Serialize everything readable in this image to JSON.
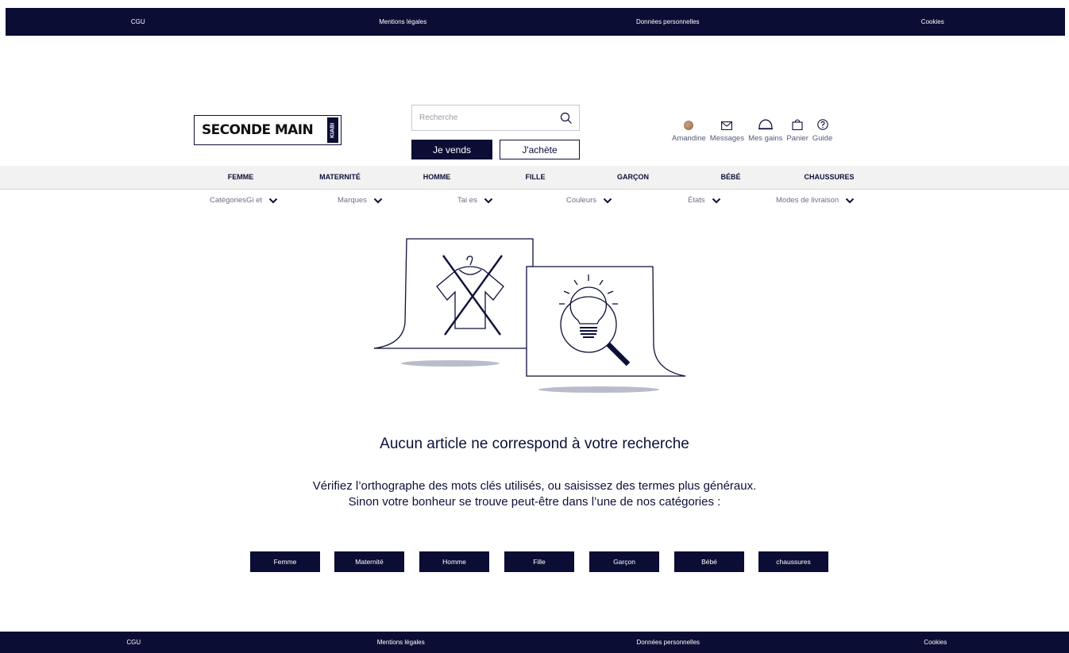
{
  "footer_links": [
    "CGU",
    "Mentions légales",
    "Données personnelles",
    "Cookies"
  ],
  "logo": {
    "text": "SECONDE MAIN",
    "badge": "KIABI"
  },
  "search": {
    "placeholder": "Recherche",
    "value": "",
    "icon": "search-icon"
  },
  "buttons": {
    "sell": "Je vends",
    "buy": "J'achète"
  },
  "user_nav": [
    {
      "label": "Amandine",
      "icon": "avatar"
    },
    {
      "label": "Messages",
      "icon": "envelope-icon"
    },
    {
      "label": "Mes gains",
      "icon": "piggy-bank-icon"
    },
    {
      "label": "Panier",
      "icon": "bag-icon"
    },
    {
      "label": "Guide",
      "icon": "help-icon"
    }
  ],
  "categories": [
    "FEMME",
    "MATERNITÉ",
    "HOMME",
    "FILLE",
    "GARÇON",
    "BÉBÉ",
    "CHAUSSURES"
  ],
  "filters": [
    "CatégoriesGi et",
    "Marques",
    "Tai es",
    "Couleurs",
    "États",
    "Modes de livraison"
  ],
  "empty_state": {
    "title": "Aucun article ne correspond à votre recherche",
    "line1": "Vérifiez l’orthographe des mots clés utilisés, ou saisissez des termes plus généraux.",
    "line2": "Sinon votre bonheur se trouve peut-être dans l’une de nos catégories :"
  },
  "category_buttons": [
    "Femme",
    "Maternité",
    "Homme",
    "Fille",
    "Garçon",
    "Bébé",
    "chaussures"
  ],
  "colors": {
    "navy": "#0b0d35",
    "category_bar": "#f2f2f2"
  }
}
